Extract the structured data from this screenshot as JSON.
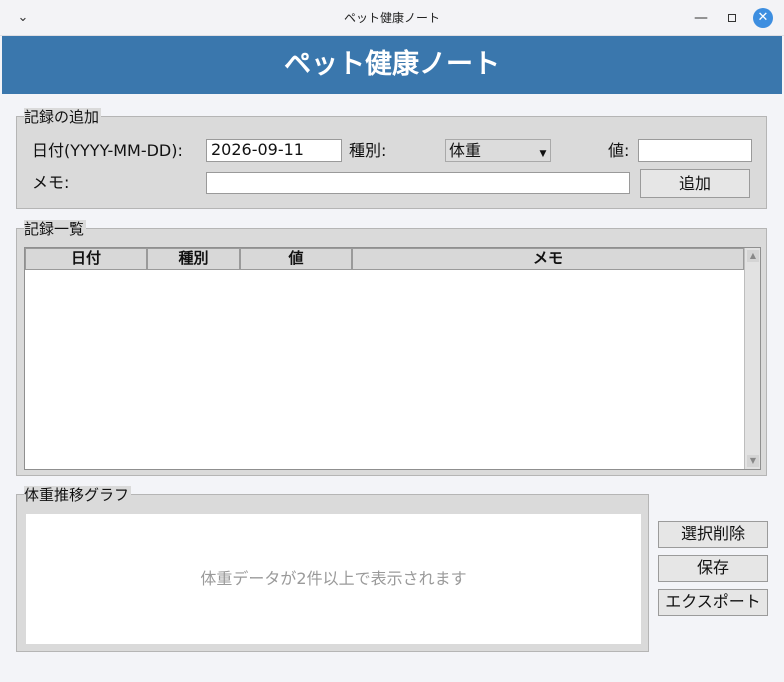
{
  "window": {
    "title": "ペット健康ノート"
  },
  "header": {
    "title": "ペット健康ノート"
  },
  "add_record": {
    "legend": "記録の追加",
    "date_label": "日付(YYYY-MM-DD):",
    "date_value": "2026-09-11",
    "kind_label": "種別:",
    "kind_value": "体重",
    "value_label": "値:",
    "value_value": "",
    "memo_label": "メモ:",
    "memo_value": "",
    "add_button": "追加"
  },
  "record_list": {
    "legend": "記録一覧",
    "columns": [
      "日付",
      "種別",
      "値",
      "メモ"
    ],
    "rows": []
  },
  "graph": {
    "legend": "体重推移グラフ",
    "placeholder": "体重データが2件以上で表示されます"
  },
  "actions": {
    "delete_selected": "選択削除",
    "save": "保存",
    "export": "エクスポート"
  },
  "icons": {
    "menu": "chevron-down-icon",
    "minimize": "minimize-icon",
    "maximize": "maximize-icon",
    "close": "close-icon",
    "dropdown": "dropdown-arrow-icon",
    "scroll_up": "scroll-up-arrow-icon",
    "scroll_down": "scroll-down-arrow-icon"
  },
  "colors": {
    "header_bg": "#3a77ad",
    "close_button": "#3d8ee0"
  }
}
